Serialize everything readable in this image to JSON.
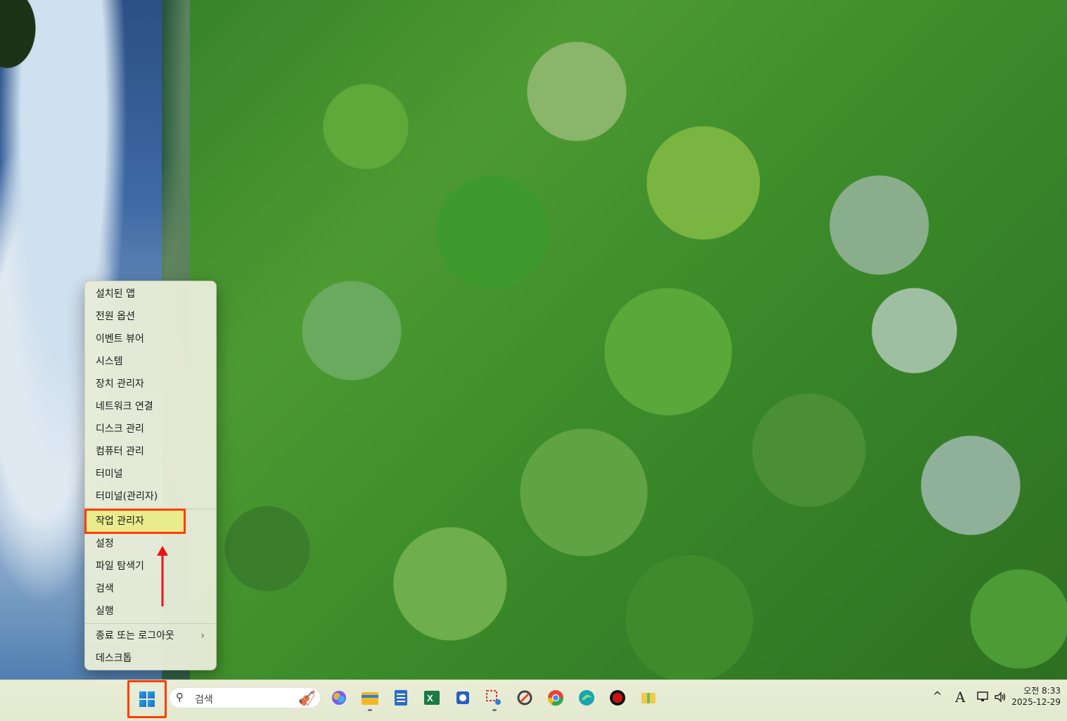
{
  "menu": {
    "items": [
      "설치된 앱",
      "전원 옵션",
      "이벤트 뷰어",
      "시스템",
      "장치 관리자",
      "네트워크 연결",
      "디스크 관리",
      "컴퓨터 관리",
      "터미널",
      "터미널(관리자)"
    ],
    "items2": [
      "작업 관리자",
      "설정",
      "파일 탐색기",
      "검색",
      "실행"
    ],
    "items3": [
      "종료 또는 로그아웃",
      "데스크톱"
    ],
    "highlighted": "작업 관리자",
    "chevron": "›"
  },
  "taskbar": {
    "search_placeholder": "검색",
    "apps": [
      {
        "name": "copilot-icon",
        "color": "#7b5cf0"
      },
      {
        "name": "file-explorer-icon",
        "color": "#f2b824"
      },
      {
        "name": "notepad-icon",
        "color": "#2d6cc8"
      },
      {
        "name": "excel-icon",
        "color": "#1d7a45"
      },
      {
        "name": "network-tool-icon",
        "color": "#2a5fc0"
      },
      {
        "name": "snipping-tool-icon",
        "color": "#d03a3a"
      },
      {
        "name": "edit-app-icon",
        "color": "#444444"
      },
      {
        "name": "chrome-icon",
        "color": "#e84335"
      },
      {
        "name": "edge-icon",
        "color": "#1aa3b0"
      },
      {
        "name": "record-icon",
        "color": "#d01010"
      },
      {
        "name": "folder-app-icon",
        "color": "#f2c94c"
      }
    ],
    "tray": {
      "chevron": "^",
      "ime": "A",
      "time": "오전 8:33",
      "date": "2025-12-29"
    }
  },
  "colors": {
    "highlight_border": "#ff3d00",
    "highlight_bg": "#e8ec8c"
  }
}
